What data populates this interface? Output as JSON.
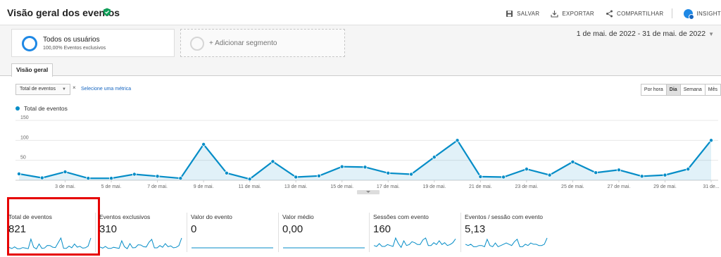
{
  "header": {
    "title": "Visão geral dos eventos",
    "actions": [
      {
        "label": "SALVAR",
        "icon": "save-icon"
      },
      {
        "label": "EXPORTAR",
        "icon": "export-icon"
      },
      {
        "label": "COMPARTILHAR",
        "icon": "share-icon"
      },
      {
        "label": "INSIGHT",
        "icon": "insights-icon"
      }
    ]
  },
  "segments": {
    "active": {
      "name": "Todos os usuários",
      "detail": "100,00% Eventos exclusivos"
    },
    "add_label": "+ Adicionar segmento"
  },
  "date_range": "1 de mai. de 2022 - 31 de mai. de 2022",
  "tabs": [
    {
      "label": "Visão geral",
      "active": true
    }
  ],
  "controls": {
    "metric_select": "Total de eventos",
    "remove_mark": "×",
    "select_metric_link": "Selecione uma métrica",
    "periods": [
      {
        "label": "Por hora",
        "active": false
      },
      {
        "label": "Dia",
        "active": true
      },
      {
        "label": "Semana",
        "active": false
      },
      {
        "label": "Mês",
        "active": false
      }
    ]
  },
  "chart_data": {
    "type": "area",
    "series": [
      {
        "name": "Total de eventos",
        "x": [
          "1 de mai.",
          "2 de mai.",
          "3 de mai.",
          "4 de mai.",
          "5 de mai.",
          "6 de mai.",
          "7 de mai.",
          "8 de mai.",
          "9 de mai.",
          "10 de mai.",
          "11 de mai.",
          "12 de mai.",
          "13 de mai.",
          "14 de mai.",
          "15 de mai.",
          "16 de mai.",
          "17 de mai.",
          "18 de mai.",
          "19 de mai.",
          "20 de mai.",
          "21 de mai.",
          "22 de mai.",
          "23 de mai.",
          "24 de mai.",
          "25 de mai.",
          "26 de mai.",
          "27 de mai.",
          "28 de mai.",
          "29 de mai.",
          "30 de mai.",
          "31 de mai."
        ],
        "values": [
          16,
          6,
          21,
          5,
          5,
          15,
          10,
          5,
          90,
          18,
          3,
          47,
          8,
          11,
          34,
          33,
          18,
          15,
          58,
          100,
          9,
          8,
          28,
          13,
          46,
          19,
          26,
          10,
          13,
          28,
          100
        ]
      }
    ],
    "xtick_labels": [
      "3 de mai.",
      "5 de mai.",
      "7 de mai.",
      "9 de mai.",
      "11 de mai.",
      "13 de mai.",
      "15 de mai.",
      "17 de mai.",
      "19 de mai.",
      "21 de mai.",
      "23 de mai.",
      "25 de mai.",
      "27 de mai.",
      "29 de mai.",
      "31 de..."
    ],
    "xtick_index": [
      2,
      4,
      6,
      8,
      10,
      12,
      14,
      16,
      18,
      20,
      22,
      24,
      26,
      28,
      30
    ],
    "yticks": [
      50,
      100,
      150
    ],
    "ylim": [
      0,
      150
    ],
    "color": "#058dc7",
    "grid": true,
    "legend": "top-left"
  },
  "scorecards": [
    {
      "label": "Total de eventos",
      "value": "821",
      "spark": [
        16,
        6,
        21,
        5,
        5,
        15,
        10,
        5,
        90,
        18,
        3,
        47,
        8,
        11,
        34,
        33,
        18,
        15,
        58,
        100,
        9,
        8,
        28,
        13,
        46,
        19,
        26,
        10,
        13,
        28,
        100
      ],
      "highlighted": true
    },
    {
      "label": "Eventos exclusivos",
      "value": "310",
      "spark": [
        8,
        4,
        10,
        3,
        3,
        7,
        5,
        3,
        30,
        9,
        2,
        20,
        5,
        6,
        16,
        15,
        9,
        8,
        25,
        35,
        5,
        5,
        13,
        7,
        20,
        9,
        12,
        5,
        7,
        13,
        40
      ],
      "highlighted": false
    },
    {
      "label": "Valor do evento",
      "value": "0",
      "spark": [
        0,
        0,
        0,
        0,
        0,
        0,
        0,
        0,
        0,
        0,
        0,
        0,
        0,
        0,
        0,
        0,
        0,
        0,
        0,
        0,
        0,
        0,
        0,
        0,
        0,
        0,
        0,
        0,
        0,
        0,
        0
      ],
      "highlighted": false
    },
    {
      "label": "Valor médio",
      "value": "0,00",
      "spark": [
        0,
        0,
        0,
        0,
        0,
        0,
        0,
        0,
        0,
        0,
        0,
        0,
        0,
        0,
        0,
        0,
        0,
        0,
        0,
        0,
        0,
        0,
        0,
        0,
        0,
        0,
        0,
        0,
        0,
        0,
        0
      ],
      "highlighted": false
    },
    {
      "label": "Sessões com evento",
      "value": "160",
      "spark": [
        4,
        3,
        6,
        3,
        3,
        5,
        4,
        3,
        12,
        6,
        2,
        9,
        4,
        5,
        8,
        7,
        5,
        5,
        10,
        12,
        4,
        4,
        7,
        5,
        9,
        5,
        7,
        4,
        5,
        7,
        11
      ],
      "highlighted": false
    },
    {
      "label": "Eventos / sessão com evento",
      "value": "5,13",
      "spark": [
        4,
        3,
        4,
        2,
        2,
        3,
        3,
        2,
        8,
        3,
        2,
        5,
        2,
        3,
        4,
        5,
        4,
        3,
        6,
        8,
        2,
        2,
        4,
        3,
        5,
        4,
        4,
        3,
        3,
        4,
        9
      ],
      "highlighted": false
    }
  ]
}
